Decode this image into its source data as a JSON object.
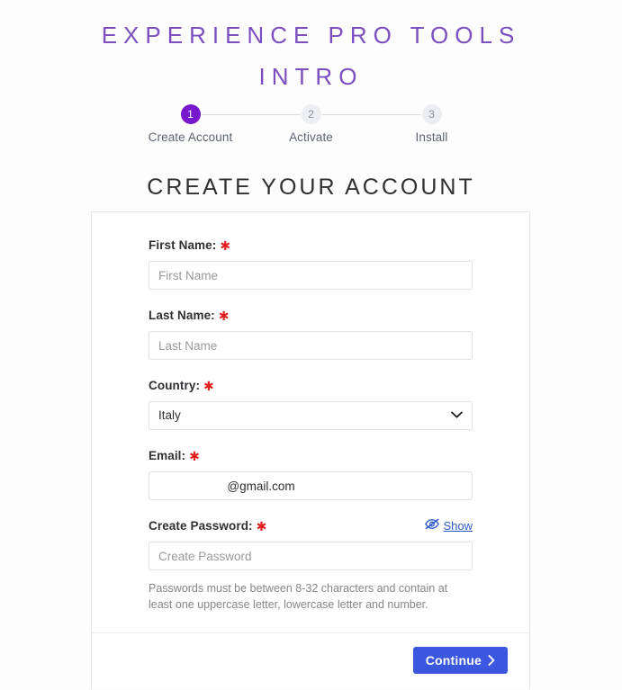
{
  "page": {
    "title_line1": "Experience Pro Tools",
    "title_line2": "Intro",
    "section_heading": "Create Your Account",
    "accent_purple": "#7718cc",
    "title_purple": "#7c4fc0",
    "accent_blue": "#3b57e0",
    "link_blue": "#2e5cc8",
    "required_red": "#e02020"
  },
  "stepper": {
    "steps": [
      {
        "number": "1",
        "label": "Create Account",
        "state": "active"
      },
      {
        "number": "2",
        "label": "Activate",
        "state": "inactive"
      },
      {
        "number": "3",
        "label": "Install",
        "state": "inactive"
      }
    ]
  },
  "form": {
    "first_name": {
      "label": "First Name:",
      "required": "✱",
      "placeholder": "First Name",
      "value": ""
    },
    "last_name": {
      "label": "Last Name:",
      "required": "✱",
      "placeholder": "Last Name",
      "value": ""
    },
    "country": {
      "label": "Country:",
      "required": "✱",
      "selected": "Italy",
      "chevron_icon": "chevron-down-icon"
    },
    "email": {
      "label": "Email:",
      "required": "✱",
      "value": "@gmail.com",
      "placeholder": ""
    },
    "password": {
      "label": "Create Password:",
      "required": "✱",
      "placeholder": "Create Password",
      "value": "",
      "show_label": "Show",
      "show_icon": "eye-slash-icon",
      "helper_text": "Passwords must be between 8-32 characters and contain at least one uppercase letter, lowercase letter and number."
    }
  },
  "footer": {
    "continue_label": "Continue",
    "continue_chevron": "chevron-right-icon"
  }
}
